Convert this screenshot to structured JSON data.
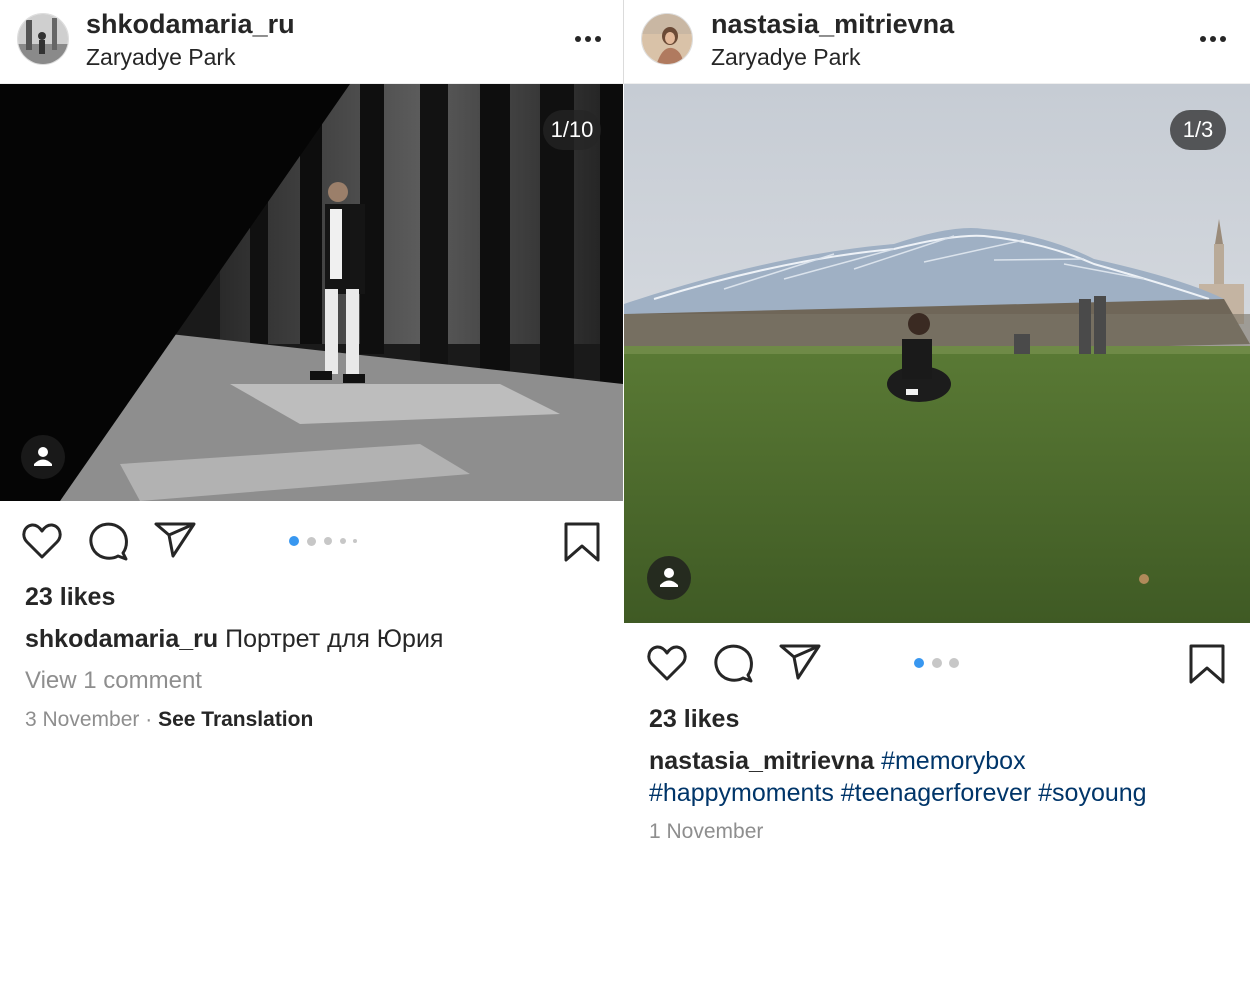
{
  "posts": [
    {
      "username": "shkodamaria_ru",
      "location": "Zaryadye Park",
      "media_counter": "1/10",
      "carousel": {
        "total_visible_dots": 5,
        "active_index": 0
      },
      "likes": "23 likes",
      "caption_user": "shkodamaria_ru",
      "caption_text": "Портрет для Юрия",
      "view_comments": "View 1 comment",
      "date": "3 November",
      "separator": "·",
      "see_translation": "See Translation"
    },
    {
      "username": "nastasia_mitrievna",
      "location": "Zaryadye Park",
      "media_counter": "1/3",
      "carousel": {
        "total_visible_dots": 3,
        "active_index": 0
      },
      "likes": "23 likes",
      "caption_user": "nastasia_mitrievna",
      "hashtags": [
        "#memorybox",
        "#happymoments",
        "#teenagerforever",
        "#soyoung"
      ],
      "date": "1 November"
    }
  ],
  "icons": {
    "more": "more-options-icon",
    "like": "heart-icon",
    "comment": "comment-icon",
    "share": "send-icon",
    "save": "bookmark-icon",
    "user_tag": "person-icon"
  },
  "colors": {
    "text": "#262626",
    "secondary": "#8e8e8e",
    "hashtag": "#003569",
    "carousel_active": "#3897f0",
    "carousel_inactive": "#c7c7c7"
  }
}
